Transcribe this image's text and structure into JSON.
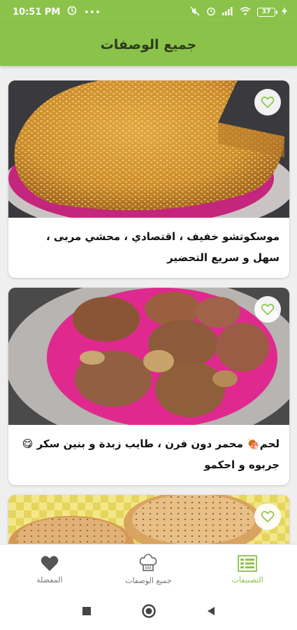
{
  "status_bar": {
    "time": "10:51 PM",
    "more": "•••",
    "battery": "37",
    "icons": [
      "data-saver-icon",
      "mute-icon",
      "alarm-icon",
      "signal-icon",
      "wifi-icon",
      "battery-icon",
      "charging-icon"
    ]
  },
  "app_bar": {
    "title": "جميع الوصفات"
  },
  "recipes": [
    {
      "title": "موسكوتشو خفيف ، اقتصادي ، محشي مربى ، سهل و سريع التحضير",
      "image": "sesame-cake-photo"
    },
    {
      "title": "لحم🍖 محمر دون فرن ، طايب زبدة و بنين سكر 😋 جربوه و احكمو",
      "image": "roasted-meat-photo"
    },
    {
      "title": "",
      "image": "bread-photo"
    }
  ],
  "bottom_nav": {
    "favorites": "المفضلة",
    "all_recipes": "جميع الوصفات",
    "categories": "التصنيفات"
  },
  "colors": {
    "primary": "#8bc34a",
    "active_tab": "#8bc34a",
    "inactive_tab": "#777777"
  }
}
